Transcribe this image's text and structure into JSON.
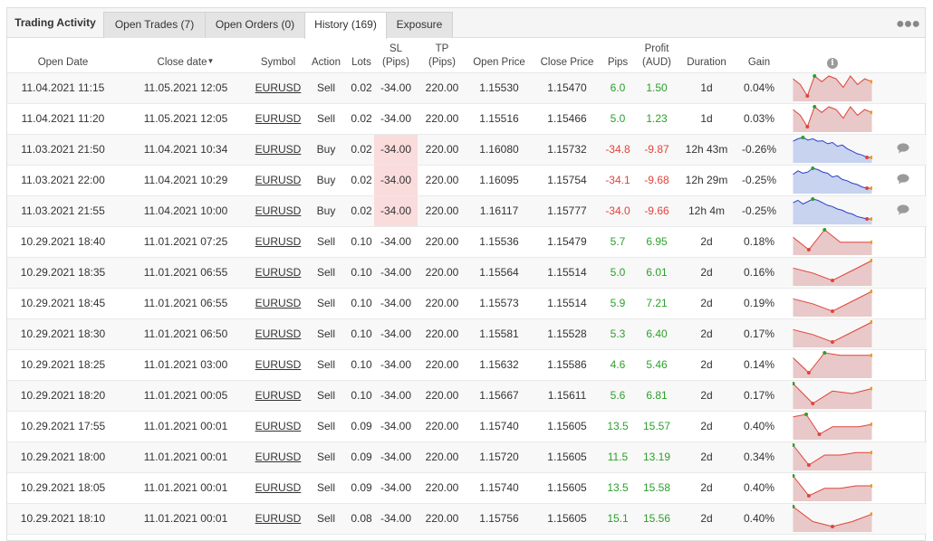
{
  "tabs": [
    {
      "label": "Trading Activity"
    },
    {
      "label": "Open Trades (7)"
    },
    {
      "label": "Open Orders (0)"
    },
    {
      "label": "History (169)"
    },
    {
      "label": "Exposure"
    }
  ],
  "more_icon": "more-dots-icon",
  "columns": {
    "open_date": "Open Date",
    "close_date": "Close date",
    "symbol": "Symbol",
    "action": "Action",
    "lots": "Lots",
    "sl_line1": "SL",
    "sl_line2": "(Pips)",
    "tp_line1": "TP",
    "tp_line2": "(Pips)",
    "open_price": "Open Price",
    "close_price": "Close Price",
    "pips": "Pips",
    "profit_line1": "Profit",
    "profit_line2": "(AUD)",
    "duration": "Duration",
    "gain": "Gain",
    "info_icon": "info-icon"
  },
  "colors": {
    "positive": "#2ca02c",
    "negative": "#e0443b",
    "sl_highlight": "#fadcdc",
    "spark_sell_line": "#e0443b",
    "spark_sell_fill": "#e8c8c8",
    "spark_buy_line": "#2d3fc8",
    "spark_buy_fill": "#c7d3ef",
    "spark_max_dot": "#2ca02c",
    "spark_min_dot": "#e0443b",
    "spark_end_dot": "#f39c12"
  },
  "rows": [
    {
      "open_date": "11.04.2021 11:15",
      "close_date": "11.05.2021 12:05",
      "symbol": "EURUSD",
      "action": "Sell",
      "lots": "0.02",
      "sl": "-34.00",
      "sl_hit": false,
      "tp": "220.00",
      "open_price": "1.15530",
      "close_price": "1.15470",
      "pips": "6.0",
      "profit": "1.50",
      "duration": "1d",
      "gain": "0.04%",
      "comment": false,
      "spark": [
        8,
        6,
        2,
        9,
        7,
        9,
        8,
        5,
        9,
        6,
        8,
        7
      ]
    },
    {
      "open_date": "11.04.2021 11:20",
      "close_date": "11.05.2021 12:05",
      "symbol": "EURUSD",
      "action": "Sell",
      "lots": "0.02",
      "sl": "-34.00",
      "sl_hit": false,
      "tp": "220.00",
      "open_price": "1.15516",
      "close_price": "1.15466",
      "pips": "5.0",
      "profit": "1.23",
      "duration": "1d",
      "gain": "0.03%",
      "comment": false,
      "spark": [
        8,
        6,
        2,
        9,
        7,
        9,
        8,
        5,
        9,
        6,
        8,
        7
      ]
    },
    {
      "open_date": "11.03.2021 21:50",
      "close_date": "11.04.2021 10:34",
      "symbol": "EURUSD",
      "action": "Buy",
      "lots": "0.02",
      "sl": "-34.00",
      "sl_hit": true,
      "tp": "220.00",
      "open_price": "1.16080",
      "close_price": "1.15732",
      "pips": "-34.8",
      "profit": "-9.87",
      "duration": "12h 43m",
      "gain": "-0.26%",
      "comment": true,
      "spark": [
        8,
        9,
        9.5,
        8.5,
        9,
        8,
        8.2,
        7,
        7.5,
        6,
        6.5,
        5,
        4,
        3,
        2.5,
        1.5,
        1.5
      ]
    },
    {
      "open_date": "11.03.2021 22:00",
      "close_date": "11.04.2021 10:29",
      "symbol": "EURUSD",
      "action": "Buy",
      "lots": "0.02",
      "sl": "-34.00",
      "sl_hit": true,
      "tp": "220.00",
      "open_price": "1.16095",
      "close_price": "1.15754",
      "pips": "-34.1",
      "profit": "-9.68",
      "duration": "12h 29m",
      "gain": "-0.25%",
      "comment": true,
      "spark": [
        7,
        8.5,
        7.5,
        8,
        9.5,
        9,
        8,
        7.5,
        6,
        6.5,
        5,
        4.5,
        3.5,
        3,
        2,
        1.5,
        1.5
      ]
    },
    {
      "open_date": "11.03.2021 21:55",
      "close_date": "11.04.2021 10:00",
      "symbol": "EURUSD",
      "action": "Buy",
      "lots": "0.02",
      "sl": "-34.00",
      "sl_hit": true,
      "tp": "220.00",
      "open_price": "1.16117",
      "close_price": "1.15777",
      "pips": "-34.0",
      "profit": "-9.66",
      "duration": "12h 4m",
      "gain": "-0.25%",
      "comment": true,
      "spark": [
        8,
        9,
        7.5,
        8.5,
        9.5,
        9,
        8,
        7,
        6.5,
        5.5,
        5,
        4,
        3.5,
        2.5,
        2,
        1.5,
        1.5
      ]
    },
    {
      "open_date": "10.29.2021 18:40",
      "close_date": "11.01.2021 07:25",
      "symbol": "EURUSD",
      "action": "Sell",
      "lots": "0.10",
      "sl": "-34.00",
      "sl_hit": false,
      "tp": "220.00",
      "open_price": "1.15536",
      "close_price": "1.15479",
      "pips": "5.7",
      "profit": "6.95",
      "duration": "2d",
      "gain": "0.18%",
      "comment": false,
      "spark": [
        6,
        1,
        9,
        4,
        4,
        4
      ]
    },
    {
      "open_date": "10.29.2021 18:35",
      "close_date": "11.01.2021 06:55",
      "symbol": "EURUSD",
      "action": "Sell",
      "lots": "0.10",
      "sl": "-34.00",
      "sl_hit": false,
      "tp": "220.00",
      "open_price": "1.15564",
      "close_price": "1.15514",
      "pips": "5.0",
      "profit": "6.01",
      "duration": "2d",
      "gain": "0.16%",
      "comment": false,
      "spark": [
        6,
        4,
        1,
        5,
        9
      ]
    },
    {
      "open_date": "10.29.2021 18:45",
      "close_date": "11.01.2021 06:55",
      "symbol": "EURUSD",
      "action": "Sell",
      "lots": "0.10",
      "sl": "-34.00",
      "sl_hit": false,
      "tp": "220.00",
      "open_price": "1.15573",
      "close_price": "1.15514",
      "pips": "5.9",
      "profit": "7.21",
      "duration": "2d",
      "gain": "0.19%",
      "comment": false,
      "spark": [
        6,
        4,
        1,
        5,
        9
      ]
    },
    {
      "open_date": "10.29.2021 18:30",
      "close_date": "11.01.2021 06:50",
      "symbol": "EURUSD",
      "action": "Sell",
      "lots": "0.10",
      "sl": "-34.00",
      "sl_hit": false,
      "tp": "220.00",
      "open_price": "1.15581",
      "close_price": "1.15528",
      "pips": "5.3",
      "profit": "6.40",
      "duration": "2d",
      "gain": "0.17%",
      "comment": false,
      "spark": [
        6,
        4,
        1,
        5,
        9
      ]
    },
    {
      "open_date": "10.29.2021 18:25",
      "close_date": "11.01.2021 03:00",
      "symbol": "EURUSD",
      "action": "Sell",
      "lots": "0.10",
      "sl": "-34.00",
      "sl_hit": false,
      "tp": "220.00",
      "open_price": "1.15632",
      "close_price": "1.15586",
      "pips": "4.6",
      "profit": "5.46",
      "duration": "2d",
      "gain": "0.14%",
      "comment": false,
      "spark": [
        7,
        1,
        9,
        8,
        8,
        8
      ]
    },
    {
      "open_date": "10.29.2021 18:20",
      "close_date": "11.01.2021 00:05",
      "symbol": "EURUSD",
      "action": "Sell",
      "lots": "0.10",
      "sl": "-34.00",
      "sl_hit": false,
      "tp": "220.00",
      "open_price": "1.15667",
      "close_price": "1.15611",
      "pips": "5.6",
      "profit": "6.81",
      "duration": "2d",
      "gain": "0.17%",
      "comment": false,
      "spark": [
        9,
        1,
        6,
        5,
        7
      ]
    },
    {
      "open_date": "10.29.2021 17:55",
      "close_date": "11.01.2021 00:01",
      "symbol": "EURUSD",
      "action": "Sell",
      "lots": "0.09",
      "sl": "-34.00",
      "sl_hit": false,
      "tp": "220.00",
      "open_price": "1.15740",
      "close_price": "1.15605",
      "pips": "13.5",
      "profit": "15.57",
      "duration": "2d",
      "gain": "0.40%",
      "comment": false,
      "spark": [
        8,
        9,
        1,
        4,
        4,
        4,
        5
      ]
    },
    {
      "open_date": "10.29.2021 18:00",
      "close_date": "11.01.2021 00:01",
      "symbol": "EURUSD",
      "action": "Sell",
      "lots": "0.09",
      "sl": "-34.00",
      "sl_hit": false,
      "tp": "220.00",
      "open_price": "1.15720",
      "close_price": "1.15605",
      "pips": "11.5",
      "profit": "13.19",
      "duration": "2d",
      "gain": "0.34%",
      "comment": false,
      "spark": [
        9,
        1,
        5,
        5,
        6,
        6
      ]
    },
    {
      "open_date": "10.29.2021 18:05",
      "close_date": "11.01.2021 00:01",
      "symbol": "EURUSD",
      "action": "Sell",
      "lots": "0.09",
      "sl": "-34.00",
      "sl_hit": false,
      "tp": "220.00",
      "open_price": "1.15740",
      "close_price": "1.15605",
      "pips": "13.5",
      "profit": "15.58",
      "duration": "2d",
      "gain": "0.40%",
      "comment": false,
      "spark": [
        9,
        1,
        4,
        4,
        5,
        5
      ]
    },
    {
      "open_date": "10.29.2021 18:10",
      "close_date": "11.01.2021 00:01",
      "symbol": "EURUSD",
      "action": "Sell",
      "lots": "0.08",
      "sl": "-34.00",
      "sl_hit": false,
      "tp": "220.00",
      "open_price": "1.15756",
      "close_price": "1.15605",
      "pips": "15.1",
      "profit": "15.56",
      "duration": "2d",
      "gain": "0.40%",
      "comment": false,
      "spark": [
        9,
        3,
        1,
        3,
        6
      ]
    }
  ]
}
